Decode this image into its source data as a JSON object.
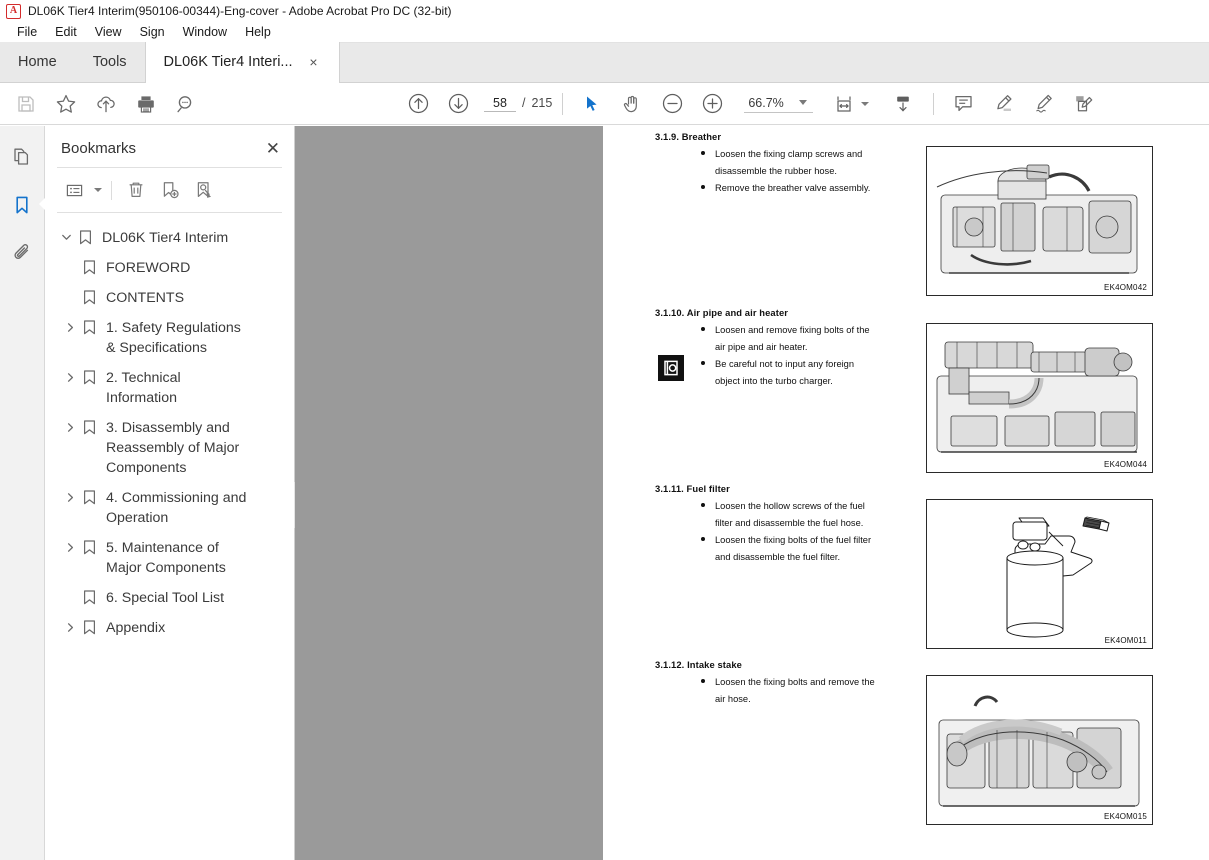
{
  "window": {
    "title": "DL06K Tier4 Interim(950106-00344)-Eng-cover - Adobe Acrobat Pro DC (32-bit)",
    "app_icon": "acrobat-icon"
  },
  "menubar": {
    "items": [
      {
        "label": "File"
      },
      {
        "label": "Edit"
      },
      {
        "label": "View"
      },
      {
        "label": "Sign"
      },
      {
        "label": "Window"
      },
      {
        "label": "Help"
      }
    ]
  },
  "tabs": [
    {
      "label": "Home",
      "active": false
    },
    {
      "label": "Tools",
      "active": false
    },
    {
      "label": "DL06K Tier4 Interi...",
      "active": true,
      "close": "×"
    }
  ],
  "toolbar": {
    "left_tools": [
      {
        "name": "save-icon",
        "title": "Save"
      },
      {
        "name": "star-icon",
        "title": "Add to favorites"
      },
      {
        "name": "cloud-upload-icon",
        "title": "Upload"
      },
      {
        "name": "print-icon",
        "title": "Print"
      },
      {
        "name": "search-icon",
        "title": "Find"
      }
    ],
    "page_prev": "previous-page-icon",
    "page_next": "next-page-icon",
    "page_current": "58",
    "page_separator": "/",
    "page_total": "215",
    "select_tool": "select-cursor-icon",
    "hand_tool": "hand-icon",
    "zoom_out": "zoom-out-icon",
    "zoom_in": "zoom-in-icon",
    "zoom_value": "66.7%",
    "fit_tool": "fit-width-icon",
    "scroll_tool": "page-scroll-icon",
    "right_tools": [
      {
        "name": "comment-icon",
        "title": "Comment"
      },
      {
        "name": "highlight-icon",
        "title": "Highlight text"
      },
      {
        "name": "sign-icon",
        "title": "Sign"
      },
      {
        "name": "fill-and-sign-icon",
        "title": "Fill & Sign"
      }
    ]
  },
  "rail": {
    "items": [
      {
        "name": "page-thumbnails-icon",
        "label": "Page Thumbnails",
        "active": false
      },
      {
        "name": "bookmarks-icon",
        "label": "Bookmarks",
        "active": true
      },
      {
        "name": "attachments-icon",
        "label": "Attachments",
        "active": false
      }
    ]
  },
  "panel": {
    "title": "Bookmarks",
    "close": "✕",
    "tools": [
      {
        "name": "options-menu-icon",
        "label": "Options"
      },
      {
        "name": "delete-bookmark-icon",
        "label": "Delete Bookmark"
      },
      {
        "name": "new-bookmark-icon",
        "label": "New Bookmark"
      },
      {
        "name": "find-bookmark-icon",
        "label": "Find Bookmark"
      }
    ],
    "tree": [
      {
        "label": "DL06K Tier4 Interim",
        "level": 0,
        "twisty": "expanded"
      },
      {
        "label": "FOREWORD",
        "level": 1,
        "twisty": "none"
      },
      {
        "label": "CONTENTS",
        "level": 1,
        "twisty": "none"
      },
      {
        "label": "1. Safety Regulations & Specifications",
        "level": 1,
        "twisty": "collapsed"
      },
      {
        "label": "2. Technical Information",
        "level": 1,
        "twisty": "collapsed"
      },
      {
        "label": "3. Disassembly and Reassembly of Major Components",
        "level": 1,
        "twisty": "collapsed"
      },
      {
        "label": "4. Commissioning and Operation",
        "level": 1,
        "twisty": "collapsed"
      },
      {
        "label": "5. Maintenance of Major Components",
        "level": 1,
        "twisty": "collapsed"
      },
      {
        "label": "6. Special Tool List",
        "level": 1,
        "twisty": "none"
      },
      {
        "label": "Appendix",
        "level": 1,
        "twisty": "collapsed"
      }
    ]
  },
  "document": {
    "sections": [
      {
        "heading": "3.1.9. Breather",
        "bullets": [
          [
            "Loosen the fixing clamp screws and",
            "disassemble the rubber hose."
          ],
          [
            "Remove the breather valve assembly."
          ]
        ],
        "figure_caption": "EK4OM042",
        "figure_name": "engine-breather-photo"
      },
      {
        "heading": "3.1.10. Air pipe and air heater",
        "bullets": [
          [
            "Loosen and remove fixing bolts of the",
            "air pipe and air heater."
          ],
          [
            "Be careful not to input any foreign",
            "object into the turbo charger."
          ]
        ],
        "figure_caption": "EK4OM044",
        "figure_name": "air-pipe-heater-photo",
        "warning_icon": "caution-note-icon"
      },
      {
        "heading": "3.1.11. Fuel filter",
        "bullets": [
          [
            "Loosen the hollow screws of the fuel",
            "filter and disassemble the fuel hose."
          ],
          [
            "Loosen the fixing bolts of the fuel filter",
            "and disassemble the fuel filter."
          ]
        ],
        "figure_caption": "EK4OM011",
        "figure_name": "fuel-filter-drawing"
      },
      {
        "heading": "3.1.12. Intake stake",
        "bullets": [
          [
            "Loosen the fixing bolts and remove the",
            "air hose."
          ]
        ],
        "figure_caption": "EK4OM015",
        "figure_name": "intake-stake-photo"
      }
    ]
  },
  "colors": {
    "accent": "#1473cc",
    "toolbar_icon": "#5e5e5e",
    "viewer_background": "#9a9a9a",
    "tab_bar": "#e9e9e9"
  }
}
